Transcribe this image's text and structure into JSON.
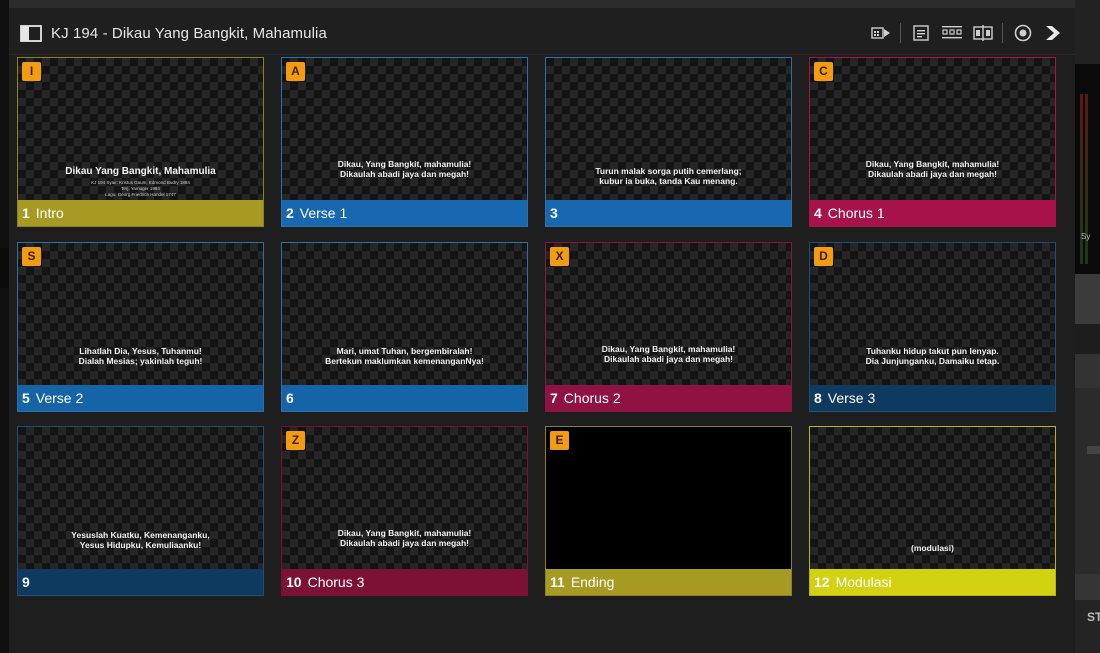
{
  "window": {
    "title": "KJ 194 - Dikau Yang Bangkit, Mahamulia"
  },
  "toolbar_icons": [
    "go-to-slide-icon",
    "clipboard-icon",
    "arrange-icon",
    "split-icon",
    "record-icon",
    "play-next-icon"
  ],
  "side_panel": {
    "meter_label": "Sy",
    "bottom_label": "ST"
  },
  "colors": {
    "intro": "#a69a23",
    "verse": "#1768b0",
    "verse_dark": "#0c4a7d",
    "chorus": "#a8124a",
    "chorus_dark": "#7d1135",
    "navy": "#0d3a5e",
    "ending": "#a69a23",
    "modulasi": "#d2d210",
    "badge": "#f39c12"
  },
  "slides": [
    {
      "badge": "I",
      "number": "1",
      "label": "Intro",
      "text": "Dikau Yang Bangkit, Mahamulia",
      "sub": "KJ 194 Syair: Kristus Gaum, Edmond Budry 1884\nTerj. Yamuger 1984\nLagu: Georg Friedrich Handel 1747",
      "bar": "#a69a23",
      "border": "#8c8220"
    },
    {
      "badge": "A",
      "number": "2",
      "label": "Verse 1",
      "text": "Dikau, Yang Bangkit, mahamulia!\nDikaulah abadi jaya dan megah!",
      "sub": "",
      "bar": "#1768b0",
      "border": "#2f6fa8"
    },
    {
      "badge": "",
      "number": "3",
      "label": "",
      "text": "Turun malak sorga putih cemerlang;\nkubur ia buka, tanda Kau menang.",
      "sub": "",
      "bar": "#1768b0",
      "border": "#2f6fa8"
    },
    {
      "badge": "C",
      "number": "4",
      "label": "Chorus 1",
      "text": "Dikau, Yang Bangkit, mahamulia!\nDikaulah abadi jaya dan megah!",
      "sub": "",
      "bar": "#a8124a",
      "border": "#a8124a"
    },
    {
      "badge": "S",
      "number": "5",
      "label": "Verse 2",
      "text": "Lihatlah Dia, Yesus, Tuhanmu!\nDialah Mesias; yakinlah teguh!",
      "sub": "",
      "bar": "#1564a8",
      "border": "#2f6fa8"
    },
    {
      "badge": "",
      "number": "6",
      "label": "",
      "text": "Mari, umat Tuhan, bergembiralah!\nBertekun maklumkan kemenanganNya!",
      "sub": "",
      "bar": "#1564a8",
      "border": "#2f6fa8"
    },
    {
      "badge": "X",
      "number": "7",
      "label": "Chorus 2",
      "text": "Dikau, Yang Bangkit, mahamulia!\nDikaulah abadi jaya dan megah!",
      "sub": "",
      "bar": "#8f1243",
      "border": "#8f1243"
    },
    {
      "badge": "D",
      "number": "8",
      "label": "Verse 3",
      "text": "Tuhanku hidup takut pun lenyap.\nDia Junjunganku, Damaiku tetap.",
      "sub": "",
      "bar": "#0d3a5e",
      "border": "#1f4f76"
    },
    {
      "badge": "",
      "number": "9",
      "label": "",
      "text": "Yesuslah Kuatku, Kemenanganku,\nYesus Hidupku, Kemuliaanku!",
      "sub": "",
      "bar": "#0d3a5e",
      "border": "#1f4f76"
    },
    {
      "badge": "Z",
      "number": "10",
      "label": "Chorus 3",
      "text": "Dikau, Yang Bangkit, mahamulia!\nDikaulah abadi jaya dan megah!",
      "sub": "",
      "bar": "#7d1135",
      "border": "#7d1135"
    },
    {
      "badge": "E",
      "number": "11",
      "label": "Ending",
      "text": "",
      "sub": "",
      "bar": "#a69a23",
      "border": "#8c8220",
      "black": true
    },
    {
      "badge": "",
      "number": "12",
      "label": "Modulasi",
      "text": "(modulasi)",
      "sub": "",
      "bar": "#d2d210",
      "border": "#b5b514"
    }
  ]
}
